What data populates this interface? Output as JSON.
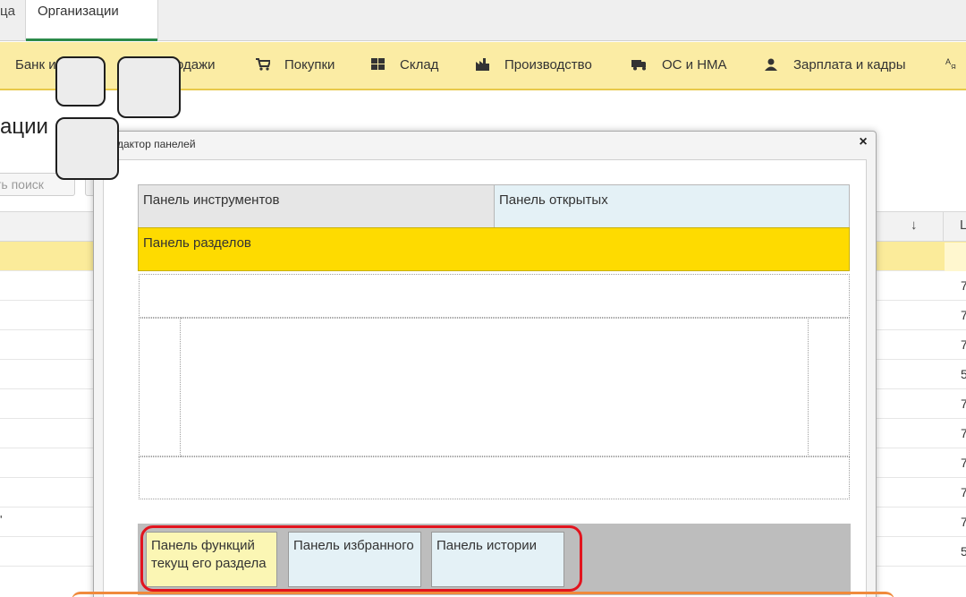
{
  "tabs": [
    {
      "label": "ца"
    },
    {
      "label": "Организации"
    }
  ],
  "sections": [
    {
      "label": "Банк и",
      "icon": "bank-icon"
    },
    {
      "label": "одажи",
      "icon": "sales-icon"
    },
    {
      "label": "Покупки",
      "icon": "cart-icon"
    },
    {
      "label": "Склад",
      "icon": "warehouse-icon"
    },
    {
      "label": "Производство",
      "icon": "factory-icon"
    },
    {
      "label": "ОС и НМА",
      "icon": "truck-icon"
    },
    {
      "label": "Зарплата и кадры",
      "icon": "person-icon"
    }
  ],
  "page": {
    "title": "ации",
    "search_placeholder": "ть поиск"
  },
  "list": {
    "sort_arrow": "↓",
    "column_letter": "Ц",
    "rows": [
      "7",
      "7",
      "7",
      "7",
      "5",
      "7",
      "7",
      "7",
      "7",
      "7",
      "5"
    ],
    "row_mark": "'"
  },
  "dialog": {
    "title": "дактор панелей",
    "close": "×",
    "panels": {
      "tools": "Панель инструментов",
      "open": "Панель открытых",
      "sections": "Панель разделов",
      "functions": "Панель функций текущ его раздела",
      "favorites": "Панель избранного",
      "history": "Панель истории"
    }
  },
  "colors": {
    "sections_bar": "#fbeca4",
    "sections_panel": "#fedb00",
    "highlight": "#e2141e",
    "active_tab_line": "#2c8a4a"
  }
}
